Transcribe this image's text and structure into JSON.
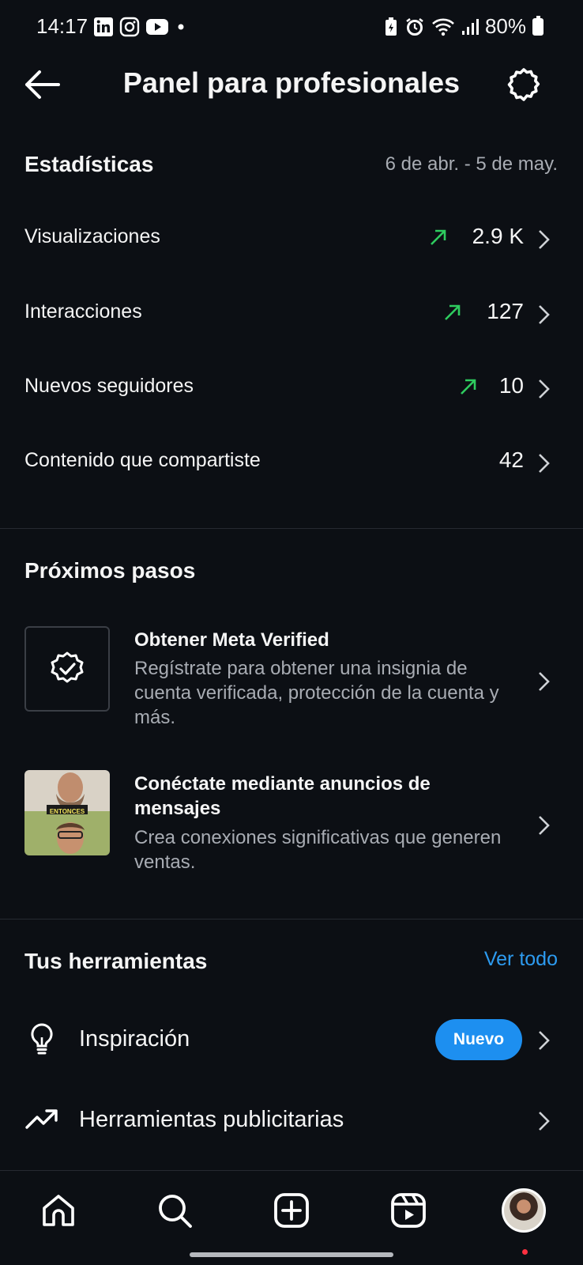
{
  "status_bar": {
    "time": "14:17",
    "battery": "80%",
    "left_icons": [
      "linkedin-icon",
      "instagram-icon",
      "youtube-icon",
      "dot"
    ],
    "right_icons": [
      "battery-saver-icon",
      "alarm-icon",
      "wifi-icon",
      "signal-icon",
      "battery-icon"
    ]
  },
  "header": {
    "title": "Panel para profesionales"
  },
  "stats": {
    "title": "Estadísticas",
    "date_range": "6 de abr. - 5 de may.",
    "rows": [
      {
        "label": "Visualizaciones",
        "value": "2.9 K",
        "trend": "up"
      },
      {
        "label": "Interacciones",
        "value": "127",
        "trend": "up"
      },
      {
        "label": "Nuevos seguidores",
        "value": "10",
        "trend": "up"
      },
      {
        "label": "Contenido que compartiste",
        "value": "42",
        "trend": ""
      }
    ]
  },
  "next_steps": {
    "title": "Próximos pasos",
    "items": [
      {
        "title": "Obtener Meta Verified",
        "desc": "Regístrate para obtener una insignia de cuenta verificada, protección de la cuenta y más.",
        "icon": "verified-badge-icon"
      },
      {
        "title": "Conéctate mediante anuncios de mensajes",
        "desc": "Crea conexiones significativas que generen ventas.",
        "thumb_caption": "ENTONCES"
      }
    ]
  },
  "tools": {
    "title": "Tus herramientas",
    "see_all": "Ver todo",
    "items": [
      {
        "label": "Inspiración",
        "badge": "Nuevo",
        "icon": "lightbulb-icon"
      },
      {
        "label": "Herramientas publicitarias",
        "icon": "trending-up-icon"
      }
    ]
  },
  "colors": {
    "background": "#0c0f14",
    "trend_up": "#2ecc5f",
    "accent": "#1d8ff0",
    "link": "#2d9bf0",
    "muted_text": "#a8acb3"
  },
  "bottom_nav": [
    "home-icon",
    "search-icon",
    "create-icon",
    "reels-icon",
    "profile-avatar"
  ]
}
